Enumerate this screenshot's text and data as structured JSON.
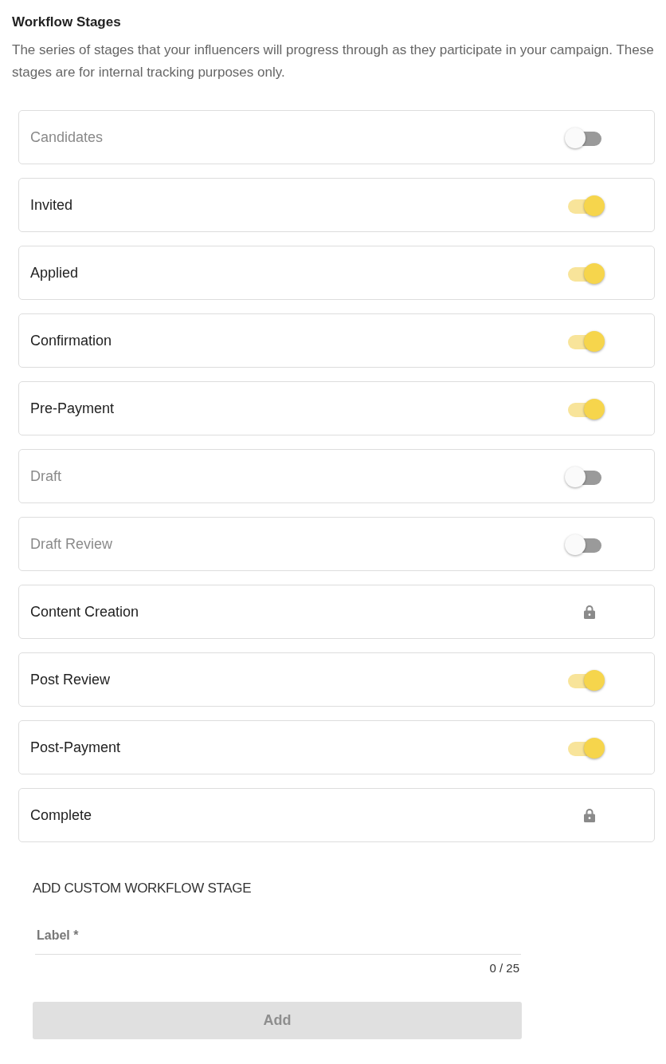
{
  "title": "Workflow Stages",
  "description": "The series of stages that your influencers will progress through as they participate in your campaign. These stages are for internal tracking purposes only.",
  "stages": [
    {
      "label": "Candidates",
      "kind": "toggle",
      "on": false
    },
    {
      "label": "Invited",
      "kind": "toggle",
      "on": true
    },
    {
      "label": "Applied",
      "kind": "toggle",
      "on": true
    },
    {
      "label": "Confirmation",
      "kind": "toggle",
      "on": true
    },
    {
      "label": "Pre-Payment",
      "kind": "toggle",
      "on": true
    },
    {
      "label": "Draft",
      "kind": "toggle",
      "on": false
    },
    {
      "label": "Draft Review",
      "kind": "toggle",
      "on": false
    },
    {
      "label": "Content Creation",
      "kind": "locked"
    },
    {
      "label": "Post Review",
      "kind": "toggle",
      "on": true
    },
    {
      "label": "Post-Payment",
      "kind": "toggle",
      "on": true
    },
    {
      "label": "Complete",
      "kind": "locked"
    }
  ],
  "custom_stage": {
    "heading": "ADD CUSTOM WORKFLOW STAGE",
    "field": {
      "placeholder": "Label *",
      "counter": "0 / 25"
    },
    "button": {
      "label": "Add",
      "disabled": true
    }
  }
}
